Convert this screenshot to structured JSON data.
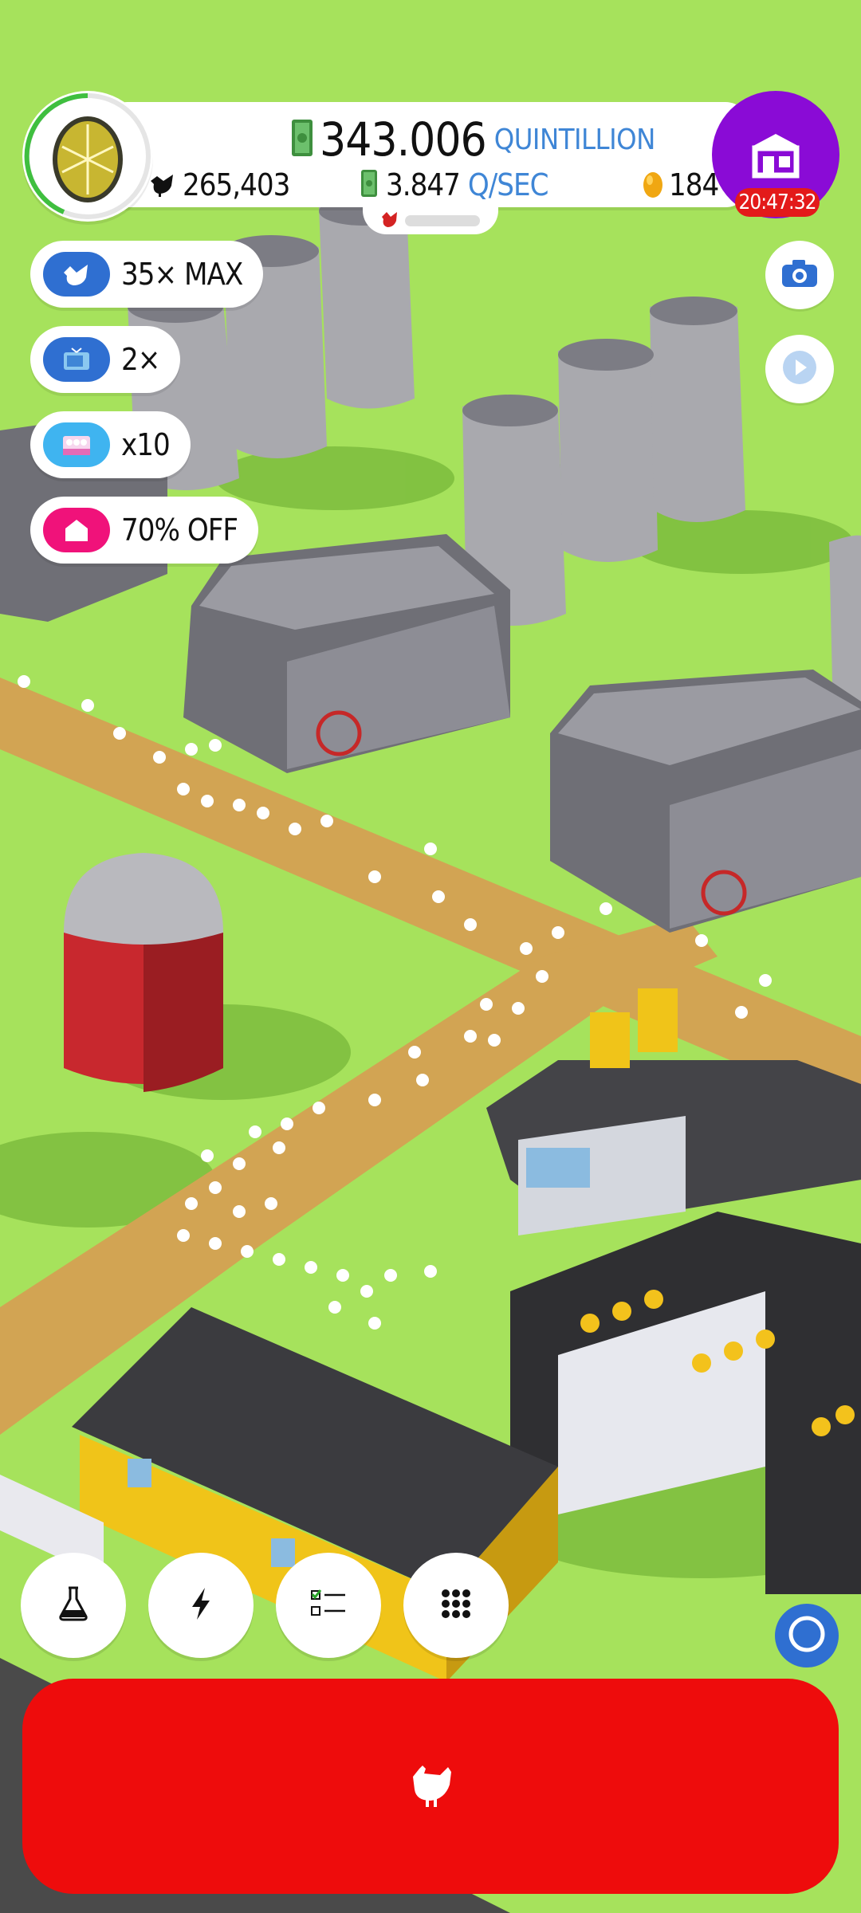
{
  "hud": {
    "money_value": "343.006",
    "money_unit": "QUINTILLION",
    "chicken_count": "265,403",
    "income_rate": "3.847",
    "income_unit": "Q/SEC",
    "golden_eggs": "184",
    "shop_timer": "20:47:32",
    "progress_fraction": 0
  },
  "boosts": [
    {
      "label": "35× MAX",
      "icon": "chicken-icon",
      "color": "#2f6fd1"
    },
    {
      "label": "2×",
      "icon": "tv-icon",
      "color": "#2f6fd1"
    },
    {
      "label": "x10",
      "icon": "egg-box-icon",
      "color": "#3fb4f0"
    },
    {
      "label": "70% OFF",
      "icon": "house-icon",
      "color": "#f0127a"
    }
  ],
  "toolbar": {
    "items": [
      "research-icon",
      "boost-icon",
      "checklist-icon",
      "grid-menu-icon"
    ]
  },
  "colors": {
    "grass": "#a6e25c",
    "road": "#d2a453",
    "hatch_button": "#ee0c0c",
    "shop": "#8a0bd6",
    "accent_blue": "#3f86d6"
  }
}
